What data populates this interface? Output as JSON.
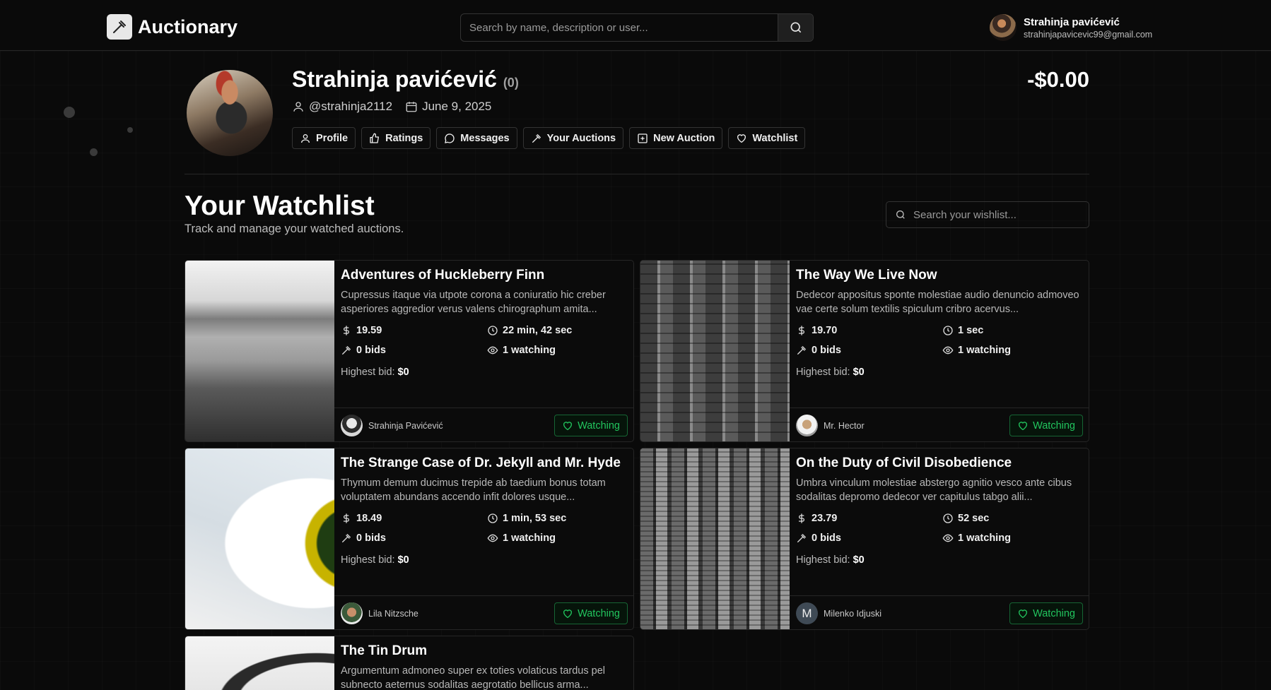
{
  "header": {
    "brand": "Auctionary",
    "search_placeholder": "Search by name, description or user...",
    "user_name": "Strahinja pavićević",
    "user_email": "strahinjapavicevic99@gmail.com"
  },
  "profile": {
    "name": "Strahinja pavićević",
    "rating_count": "(0)",
    "username": "@strahinja2112",
    "joined": "June 9, 2025",
    "balance": "-$0.00",
    "nav": [
      {
        "label": "Profile",
        "icon": "user-icon"
      },
      {
        "label": "Ratings",
        "icon": "thumbs-up-icon"
      },
      {
        "label": "Messages",
        "icon": "message-icon"
      },
      {
        "label": "Your Auctions",
        "icon": "gavel-icon"
      },
      {
        "label": "New Auction",
        "icon": "plus-square-icon"
      },
      {
        "label": "Watchlist",
        "icon": "heart-icon"
      }
    ]
  },
  "watchlist": {
    "title": "Your Watchlist",
    "subtitle": "Track and manage your watched auctions.",
    "search_placeholder": "Search your wishlist...",
    "highest_bid_label": "Highest bid:",
    "watch_label": "Watching",
    "items": [
      {
        "title": "Adventures of Huckleberry Finn",
        "description": "Cupressus itaque via utpote corona a coniuratio hic creber asperiores aggredior verus valens chirographum amita...",
        "price": "19.59",
        "time_left": "22 min, 42 sec",
        "bids": "0 bids",
        "watching": "1 watching",
        "highest_bid": "$0",
        "seller": "Strahinja Pavićević",
        "seller_initial": ""
      },
      {
        "title": "The Way We Live Now",
        "description": "Dedecor appositus sponte molestiae audio denuncio admoveo vae certe solum textilis spiculum cribro acervus...",
        "price": "19.70",
        "time_left": "1 sec",
        "bids": "0 bids",
        "watching": "1 watching",
        "highest_bid": "$0",
        "seller": "Mr. Hector",
        "seller_initial": ""
      },
      {
        "title": "The Strange Case of Dr. Jekyll and Mr. Hyde",
        "description": "Thymum demum ducimus trepide ab taedium bonus totam voluptatem abundans accendo infit dolores usque...",
        "price": "18.49",
        "time_left": "1 min, 53 sec",
        "bids": "0 bids",
        "watching": "1 watching",
        "highest_bid": "$0",
        "seller": "Lila Nitzsche",
        "seller_initial": ""
      },
      {
        "title": "On the Duty of Civil Disobedience",
        "description": "Umbra vinculum molestiae abstergo agnitio vesco ante cibus sodalitas depromo dedecor ver capitulus tabgo alii...",
        "price": "23.79",
        "time_left": "52 sec",
        "bids": "0 bids",
        "watching": "1 watching",
        "highest_bid": "$0",
        "seller": "Milenko Idjuski",
        "seller_initial": "M"
      },
      {
        "title": "The Tin Drum",
        "description": "Argumentum admoneo super ex toties volaticus tardus pel subnecto aeternus sodalitas aegrotatio bellicus arma...",
        "price": "",
        "time_left": "",
        "bids": "",
        "watching": "",
        "highest_bid": "",
        "seller": "",
        "seller_initial": ""
      }
    ]
  }
}
